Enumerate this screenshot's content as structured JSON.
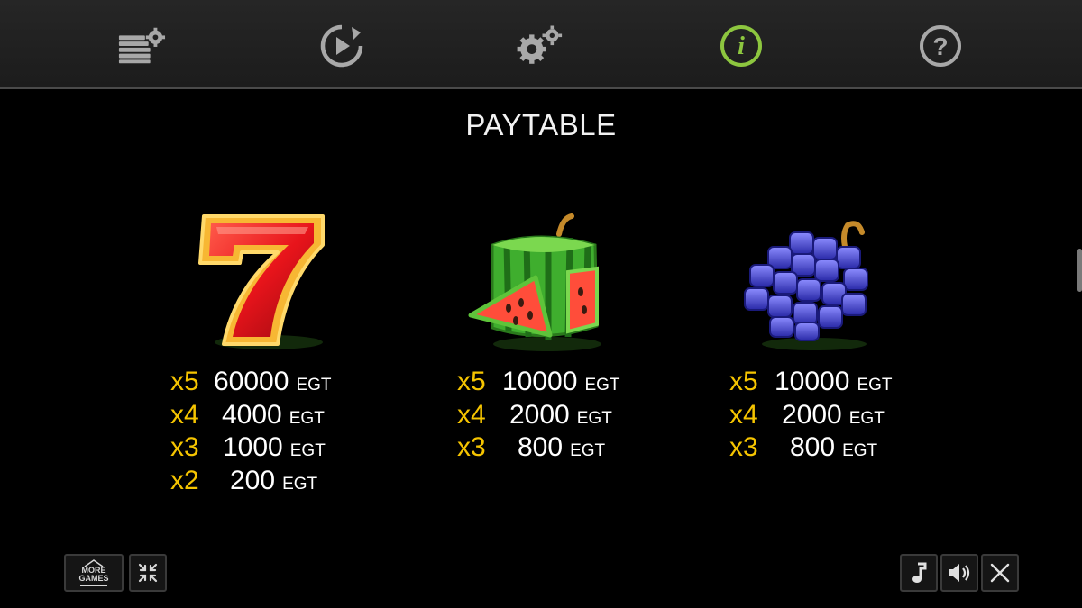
{
  "toolbar": {
    "items": [
      {
        "icon": "bet-settings-icon",
        "active": false
      },
      {
        "icon": "autoplay-icon",
        "active": false
      },
      {
        "icon": "settings-icon",
        "active": false
      },
      {
        "icon": "info-icon",
        "active": true
      },
      {
        "icon": "help-icon",
        "active": false
      }
    ],
    "active_color": "#8dc63f",
    "icon_color": "#a8a8a8"
  },
  "page": {
    "title": "PAYTABLE"
  },
  "symbols": [
    {
      "icon": "seven-icon",
      "payouts": [
        {
          "mult": "x5",
          "amount": "60000",
          "currency": "EGT"
        },
        {
          "mult": "x4",
          "amount": "4000",
          "currency": "EGT"
        },
        {
          "mult": "x3",
          "amount": "1000",
          "currency": "EGT"
        },
        {
          "mult": "x2",
          "amount": "200",
          "currency": "EGT"
        }
      ]
    },
    {
      "icon": "watermelon-icon",
      "payouts": [
        {
          "mult": "x5",
          "amount": "10000",
          "currency": "EGT"
        },
        {
          "mult": "x4",
          "amount": "2000",
          "currency": "EGT"
        },
        {
          "mult": "x3",
          "amount": "800",
          "currency": "EGT"
        }
      ]
    },
    {
      "icon": "grapes-icon",
      "payouts": [
        {
          "mult": "x5",
          "amount": "10000",
          "currency": "EGT"
        },
        {
          "mult": "x4",
          "amount": "2000",
          "currency": "EGT"
        },
        {
          "mult": "x3",
          "amount": "800",
          "currency": "EGT"
        }
      ]
    }
  ],
  "bottom": {
    "more_games_line1": "MORE",
    "more_games_line2": "GAMES"
  },
  "colors": {
    "multiplier": "#f5c400",
    "amount": "#ffffff",
    "background": "#000000"
  }
}
